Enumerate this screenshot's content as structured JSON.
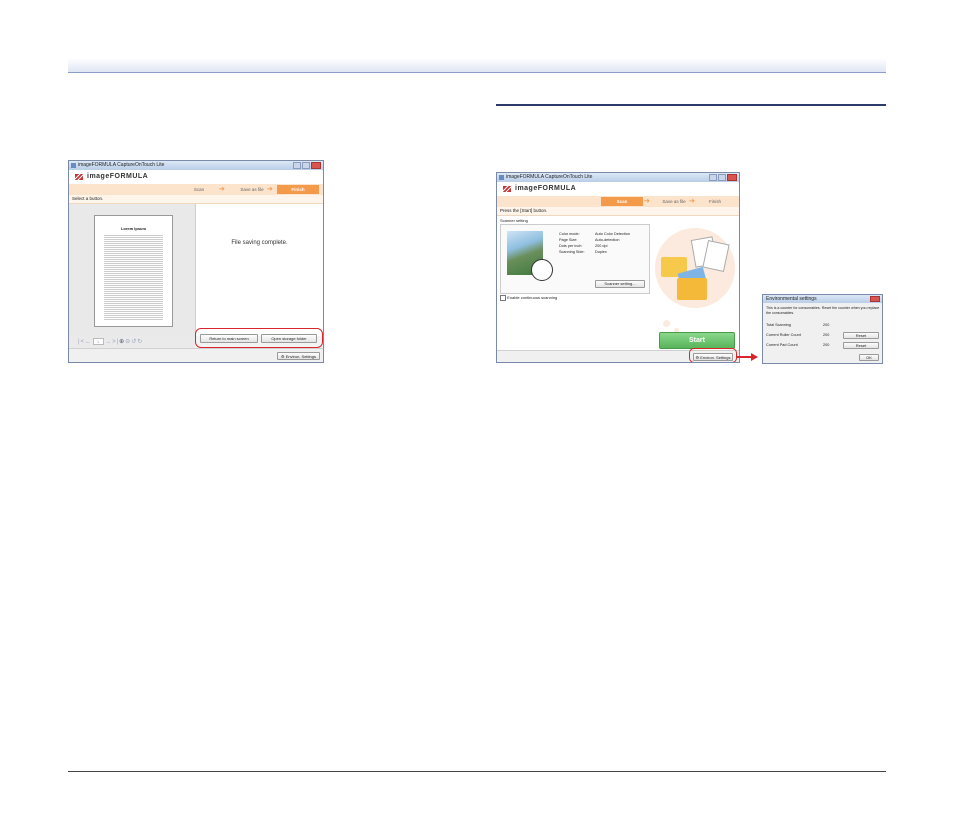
{
  "win1": {
    "title": "imageFORMULA CaptureOnTouch Lite",
    "logo": "imageFORMULA",
    "steps": [
      "Scan",
      "Save as file",
      "Finish"
    ],
    "prompt": "Select a button.",
    "doc_title": "Lorem Ipsum",
    "message": "File saving complete.",
    "buttons": {
      "return": "Return to main screen",
      "open": "Open storage folder"
    },
    "page_num": "1",
    "env_button": "Environ. Settings"
  },
  "win2": {
    "title": "imageFORMULA CaptureOnTouch Lite",
    "logo": "imageFORMULA",
    "steps": [
      "Scan",
      "Save as file",
      "Finish"
    ],
    "prompt": "Press the [Start] button.",
    "scanner_heading": "Scanner setting",
    "settings": [
      {
        "label": "Color mode:",
        "value": "Auto Color Detection"
      },
      {
        "label": "Page Size:",
        "value": "Auto-detection"
      },
      {
        "label": "Dots per inch:",
        "value": "200 dpi"
      },
      {
        "label": "Scanning Side:",
        "value": "Duplex"
      }
    ],
    "scanner_btn": "Scanner setting...",
    "continuous": "Enable continuous scanning",
    "start": "Start",
    "env_button": "Environ. Settings"
  },
  "dialog": {
    "title": "Environmental settings",
    "desc": "This is a counter for consumables. Reset the counter when you replace the consumables.",
    "rows": [
      {
        "label": "Total Scanning",
        "value": "200"
      },
      {
        "label": "Current Roller Count",
        "value": "200",
        "button": "Reset"
      },
      {
        "label": "Current Pad Count",
        "value": "200",
        "button": "Reset"
      }
    ],
    "ok": "OK"
  },
  "colors": {
    "accent": "#f39a4b",
    "highlight": "#d9262c",
    "start": "#6cc26e",
    "rule": "#2d3b6b"
  }
}
